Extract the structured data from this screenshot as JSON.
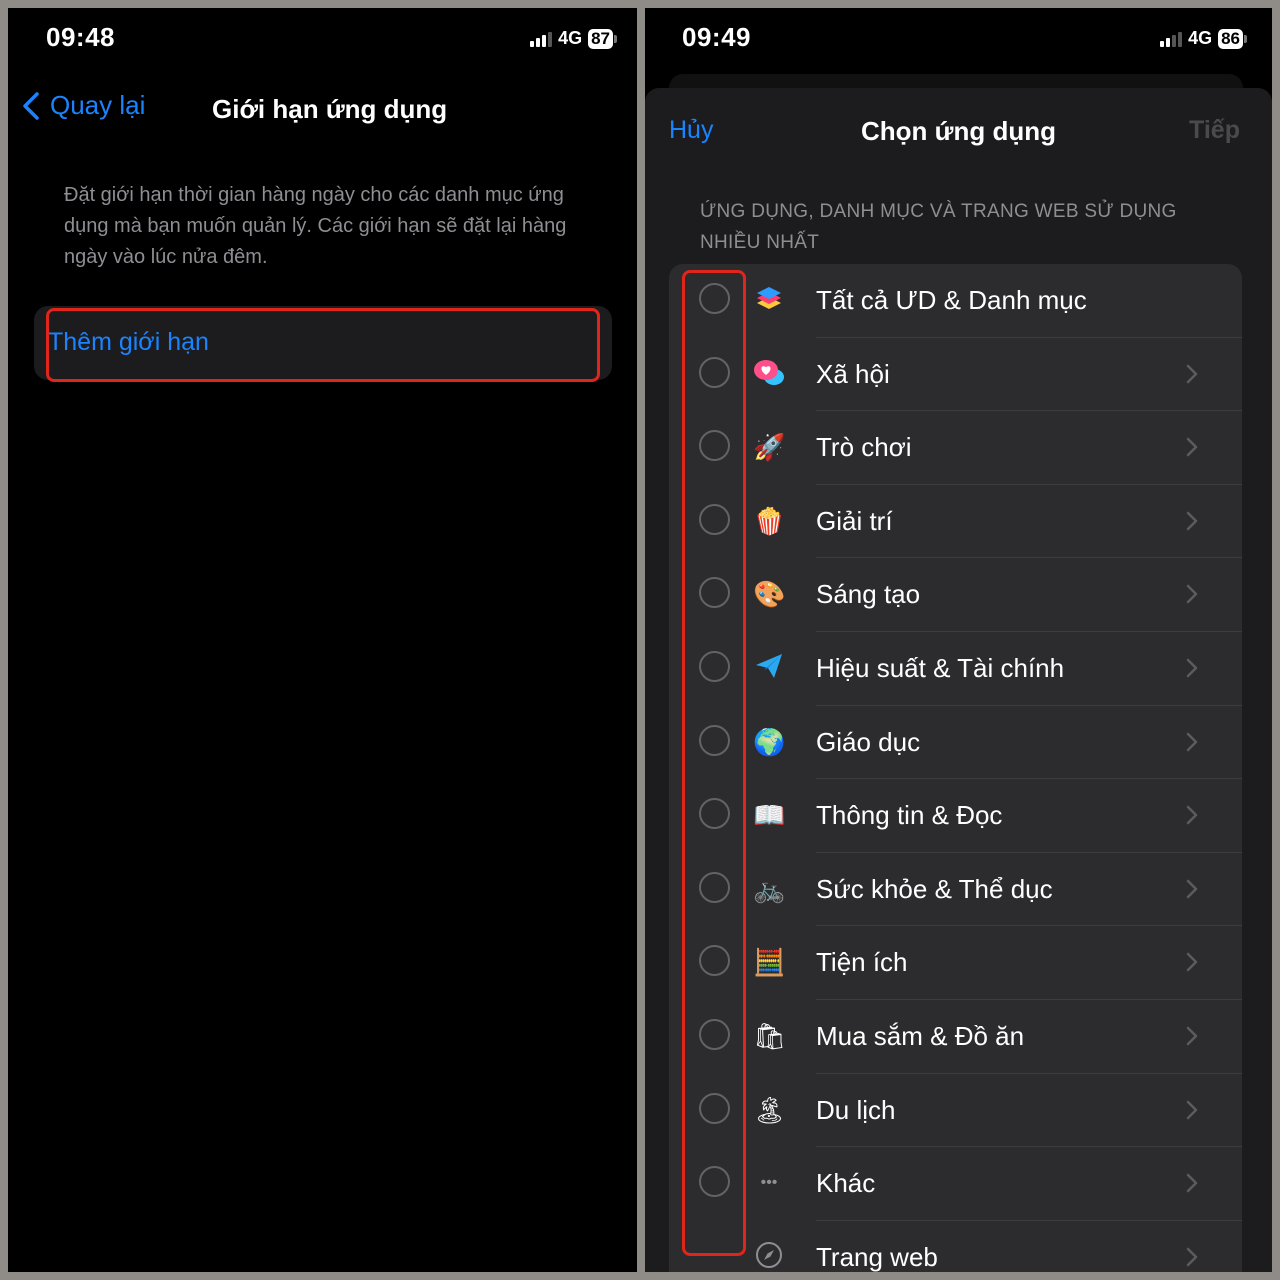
{
  "left": {
    "status": {
      "time": "09:48",
      "network": "4G",
      "battery": "87"
    },
    "nav": {
      "back_label": "Quay lại",
      "title": "Giới hạn ứng dụng"
    },
    "description": "Đặt giới hạn thời gian hàng ngày cho các danh mục ứng dụng mà bạn muốn quản lý. Các giới hạn sẽ đặt lại hàng ngày vào lúc nửa đêm.",
    "add_limit_label": "Thêm giới hạn"
  },
  "right": {
    "status": {
      "time": "09:49",
      "network": "4G",
      "battery": "86"
    },
    "sheet": {
      "cancel_label": "Hủy",
      "title": "Chọn ứng dụng",
      "next_label": "Tiếp"
    },
    "section_header": "ỨNG DỤNG, DANH MỤC VÀ TRANG WEB SỬ DỤNG NHIỀU NHẤT",
    "categories": [
      {
        "label": "Tất cả ƯD & Danh mục",
        "icon": "stack-icon",
        "glyph": "",
        "has_radio": true,
        "has_chevron": false
      },
      {
        "label": "Xã hội",
        "icon": "social-bubble-icon",
        "glyph": "",
        "has_radio": true,
        "has_chevron": true
      },
      {
        "label": "Trò chơi",
        "icon": "rocket-icon",
        "glyph": "🚀",
        "has_radio": true,
        "has_chevron": true
      },
      {
        "label": "Giải trí",
        "icon": "popcorn-icon",
        "glyph": "🍿",
        "has_radio": true,
        "has_chevron": true
      },
      {
        "label": "Sáng tạo",
        "icon": "palette-icon",
        "glyph": "🎨",
        "has_radio": true,
        "has_chevron": true
      },
      {
        "label": "Hiệu suất & Tài chính",
        "icon": "paper-plane-icon",
        "glyph": "",
        "has_radio": true,
        "has_chevron": true
      },
      {
        "label": "Giáo dục",
        "icon": "globe-icon",
        "glyph": "🌍",
        "has_radio": true,
        "has_chevron": true
      },
      {
        "label": "Thông tin & Đọc",
        "icon": "book-icon",
        "glyph": "📖",
        "has_radio": true,
        "has_chevron": true
      },
      {
        "label": "Sức khỏe & Thể dục",
        "icon": "bicycle-icon",
        "glyph": "🚲",
        "has_radio": true,
        "has_chevron": true
      },
      {
        "label": "Tiện ích",
        "icon": "calculator-icon",
        "glyph": "🧮",
        "has_radio": true,
        "has_chevron": true
      },
      {
        "label": "Mua sắm & Đồ ăn",
        "icon": "shopping-bag-icon",
        "glyph": "🛍",
        "has_radio": true,
        "has_chevron": true
      },
      {
        "label": "Du lịch",
        "icon": "island-icon",
        "glyph": "🏝",
        "has_radio": true,
        "has_chevron": true
      },
      {
        "label": "Khác",
        "icon": "more-dots-icon",
        "glyph": "•••",
        "has_radio": true,
        "has_chevron": true
      },
      {
        "label": "Trang web",
        "icon": "compass-icon",
        "glyph": "",
        "has_radio": false,
        "has_chevron": true
      }
    ]
  },
  "colors": {
    "accent": "#1a84ff",
    "highlight": "#e0251b",
    "background": "#000000",
    "card": "#2c2c2e"
  }
}
